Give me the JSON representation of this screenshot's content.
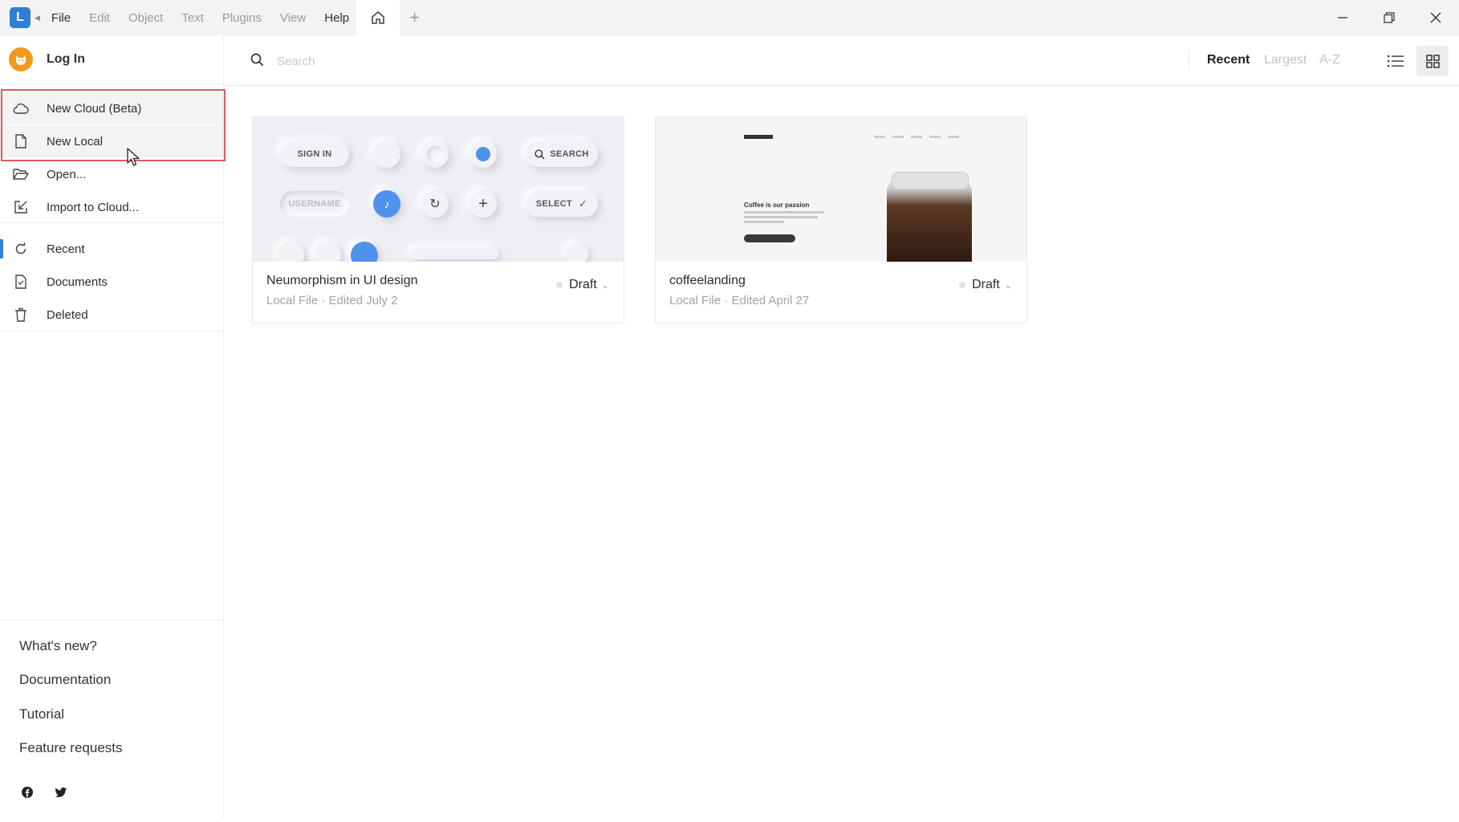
{
  "titlebar": {
    "logo_letter": "L",
    "menu": [
      "File",
      "Edit",
      "Object",
      "Text",
      "Plugins",
      "View",
      "Help"
    ]
  },
  "sidebar": {
    "login_label": "Log In",
    "actions": [
      {
        "label": "New Cloud (Beta)",
        "icon": "cloud-icon"
      },
      {
        "label": "New Local",
        "icon": "file-icon"
      },
      {
        "label": "Open...",
        "icon": "folder-open-icon"
      },
      {
        "label": "Import to Cloud...",
        "icon": "import-icon"
      }
    ],
    "nav": [
      {
        "label": "Recent",
        "icon": "refresh-icon"
      },
      {
        "label": "Documents",
        "icon": "document-icon"
      },
      {
        "label": "Deleted",
        "icon": "trash-icon"
      }
    ],
    "footer_links": [
      "What's new?",
      "Documentation",
      "Tutorial",
      "Feature requests"
    ],
    "social": [
      "facebook-icon",
      "twitter-icon"
    ]
  },
  "topbar": {
    "search_placeholder": "Search",
    "sort_options": [
      "Recent",
      "Largest",
      "A-Z"
    ],
    "active_sort": "Recent",
    "active_view": "grid"
  },
  "files": [
    {
      "title": "Neumorphism in UI design",
      "subtitle": "Local File · Edited July 2",
      "status": "Draft",
      "thumb": {
        "sign_in": "SIGN IN",
        "search": "SEARCH",
        "username": "USERNAME",
        "select": "SELECT"
      }
    },
    {
      "title": "coffeelanding",
      "subtitle": "Local File · Edited April 27",
      "status": "Draft",
      "thumb": {
        "headline": "Coffee is our passion"
      }
    }
  ],
  "colors": {
    "accent": "#2f7fd6",
    "avatar": "#f39a1d",
    "highlight": "#e05a63"
  }
}
